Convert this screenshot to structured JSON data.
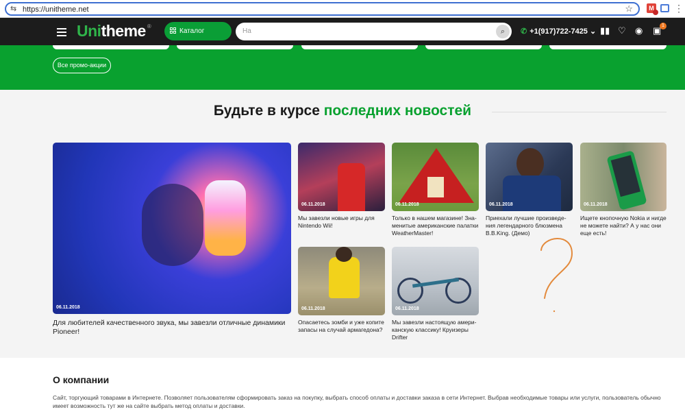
{
  "browser": {
    "url": "https://unitheme.net"
  },
  "header": {
    "logo_accent": "Uni",
    "logo_rest": "theme",
    "logo_sup": "®",
    "catalog_label": "Каталог товаров",
    "search_placeholder": "На",
    "phone": "+1(917)722-7425",
    "cart_count": "1"
  },
  "promo": {
    "all_button": "Все промо-акции"
  },
  "news": {
    "title_plain": "Будьте в курсе",
    "title_accent": "последних новостей",
    "featured": {
      "date": "06.11.2018",
      "caption": "Для любителей качественного звука, мы завезли отличные динамики Pioneer!"
    },
    "items": [
      {
        "date": "06.11.2018",
        "caption": "Мы завезли новые игры для Nintendo Wii!"
      },
      {
        "date": "06.11.2018",
        "caption": "Только в нашем магазине! Зна-менитые американские палатки WeatherMaster!"
      },
      {
        "date": "06.11.2018",
        "caption": "Приехали лучшие произведе-ния легендарного блюзмена B.B.King. (Демо)"
      },
      {
        "date": "06.11.2018",
        "caption": "Ищете кнопочную Nokia и нигде не можете найти? А у нас они еще есть!"
      },
      {
        "date": "06.11.2018",
        "caption": "Опасаетесь зомби и уже копите запасы на случай армагедона?"
      },
      {
        "date": "06.11.2018",
        "caption": "Мы завезли настоящую амери-канскую классику! Круизеры Drifter"
      }
    ]
  },
  "about": {
    "title": "О компании",
    "text": "Сайт, торгующий товарами в Интернете. Позволяет пользователям сформировать заказ на покупку, выбрать способ оплаты и доставки заказа в сети Интернет. Выбрав необходимые товары или услуги, пользователь обычно имеет возможность тут же на сайте выбрать метод оплаты и доставки."
  },
  "colors": {
    "brand_green": "#09a12f",
    "header_bg": "#1c1c1c",
    "badge_orange": "#f07820"
  }
}
